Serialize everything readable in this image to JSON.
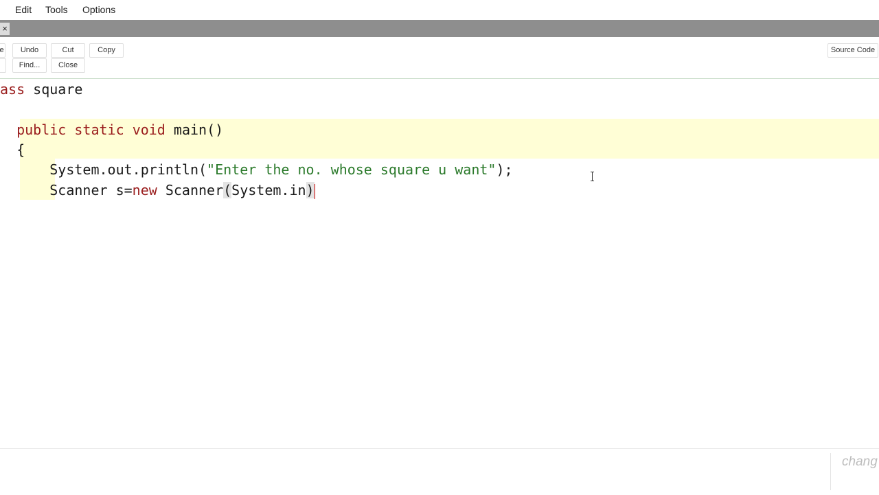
{
  "menubar": {
    "items": [
      "Edit",
      "Tools",
      "Options"
    ]
  },
  "tab": {
    "close_glyph": "×"
  },
  "toolbar": {
    "partial_label": "e",
    "undo": "Undo",
    "cut": "Cut",
    "copy": "Copy",
    "find": "Find...",
    "close": "Close",
    "source_code": "Source Code"
  },
  "editor": {
    "line1": {
      "keyword": "ass",
      "name": " square"
    },
    "line2": {
      "indent": "  ",
      "kw1": "public",
      "t1": " ",
      "kw2": "static",
      "t2": " ",
      "kw3": "void",
      "t3": " main()"
    },
    "line3": {
      "text": "  {"
    },
    "line4": {
      "prefix": "      System.out.println(",
      "str": "\"Enter the no. whose square u want\"",
      "suffix": ");"
    },
    "line5": {
      "prefix": "      Scanner s=",
      "kw": "new",
      "mid": " Scanner",
      "open": "(",
      "inner": "System.in",
      "close": ")"
    }
  },
  "status": {
    "text": "chang"
  }
}
